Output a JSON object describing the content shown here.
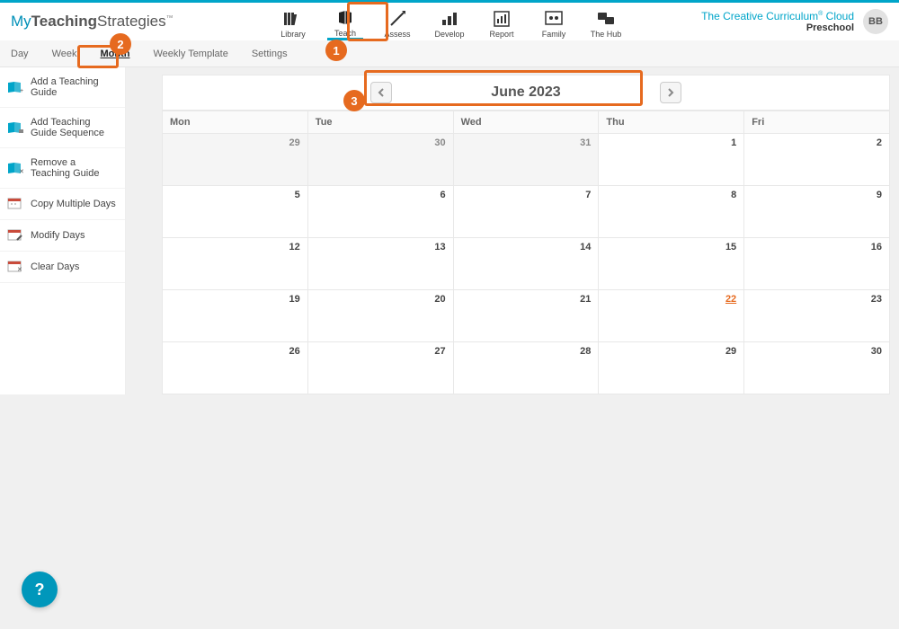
{
  "logo": {
    "my": "My",
    "teaching": "Teaching",
    "strategies": "Strategies",
    "tm": "™"
  },
  "topnav": [
    {
      "label": "Library",
      "icon": "library-icon"
    },
    {
      "label": "Teach",
      "icon": "teach-icon",
      "active": true
    },
    {
      "label": "Assess",
      "icon": "assess-icon"
    },
    {
      "label": "Develop",
      "icon": "develop-icon"
    },
    {
      "label": "Report",
      "icon": "report-icon"
    },
    {
      "label": "Family",
      "icon": "family-icon"
    },
    {
      "label": "The Hub",
      "icon": "hub-icon"
    }
  ],
  "brand": {
    "line": "The Creative Curriculum",
    "reg": "®",
    "cloud": " Cloud",
    "sub": "Preschool"
  },
  "avatar": "BB",
  "subnav": [
    {
      "label": "Day"
    },
    {
      "label": "Week"
    },
    {
      "label": "Month",
      "active": true
    },
    {
      "label": "Weekly Template"
    },
    {
      "label": "Settings"
    }
  ],
  "sidebar": [
    {
      "label": "Add a Teaching Guide",
      "icon": "guide-add-icon",
      "color": "#00a5c9"
    },
    {
      "label": "Add Teaching Guide Sequence",
      "icon": "guide-seq-icon",
      "color": "#00a5c9"
    },
    {
      "label": "Remove a Teaching Guide",
      "icon": "guide-remove-icon",
      "color": "#00a5c9"
    },
    {
      "label": "Copy Multiple Days",
      "icon": "copy-days-icon",
      "color": "#c94b3b"
    },
    {
      "label": "Modify Days",
      "icon": "modify-days-icon",
      "color": "#c94b3b"
    },
    {
      "label": "Clear Days",
      "icon": "clear-days-icon",
      "color": "#c94b3b"
    }
  ],
  "month": {
    "title": "June 2023"
  },
  "weekdays": [
    "Mon",
    "Tue",
    "Wed",
    "Thu",
    "Fri"
  ],
  "weeks": [
    [
      {
        "n": "29",
        "other": true
      },
      {
        "n": "30",
        "other": true
      },
      {
        "n": "31",
        "other": true
      },
      {
        "n": "1"
      },
      {
        "n": "2"
      }
    ],
    [
      {
        "n": "5"
      },
      {
        "n": "6"
      },
      {
        "n": "7"
      },
      {
        "n": "8"
      },
      {
        "n": "9"
      }
    ],
    [
      {
        "n": "12"
      },
      {
        "n": "13"
      },
      {
        "n": "14"
      },
      {
        "n": "15"
      },
      {
        "n": "16"
      }
    ],
    [
      {
        "n": "19"
      },
      {
        "n": "20"
      },
      {
        "n": "21"
      },
      {
        "n": "22",
        "today": true
      },
      {
        "n": "23"
      }
    ],
    [
      {
        "n": "26"
      },
      {
        "n": "27"
      },
      {
        "n": "28"
      },
      {
        "n": "29"
      },
      {
        "n": "30"
      }
    ]
  ],
  "callouts": {
    "1": "1",
    "2": "2",
    "3": "3"
  },
  "help": "?"
}
